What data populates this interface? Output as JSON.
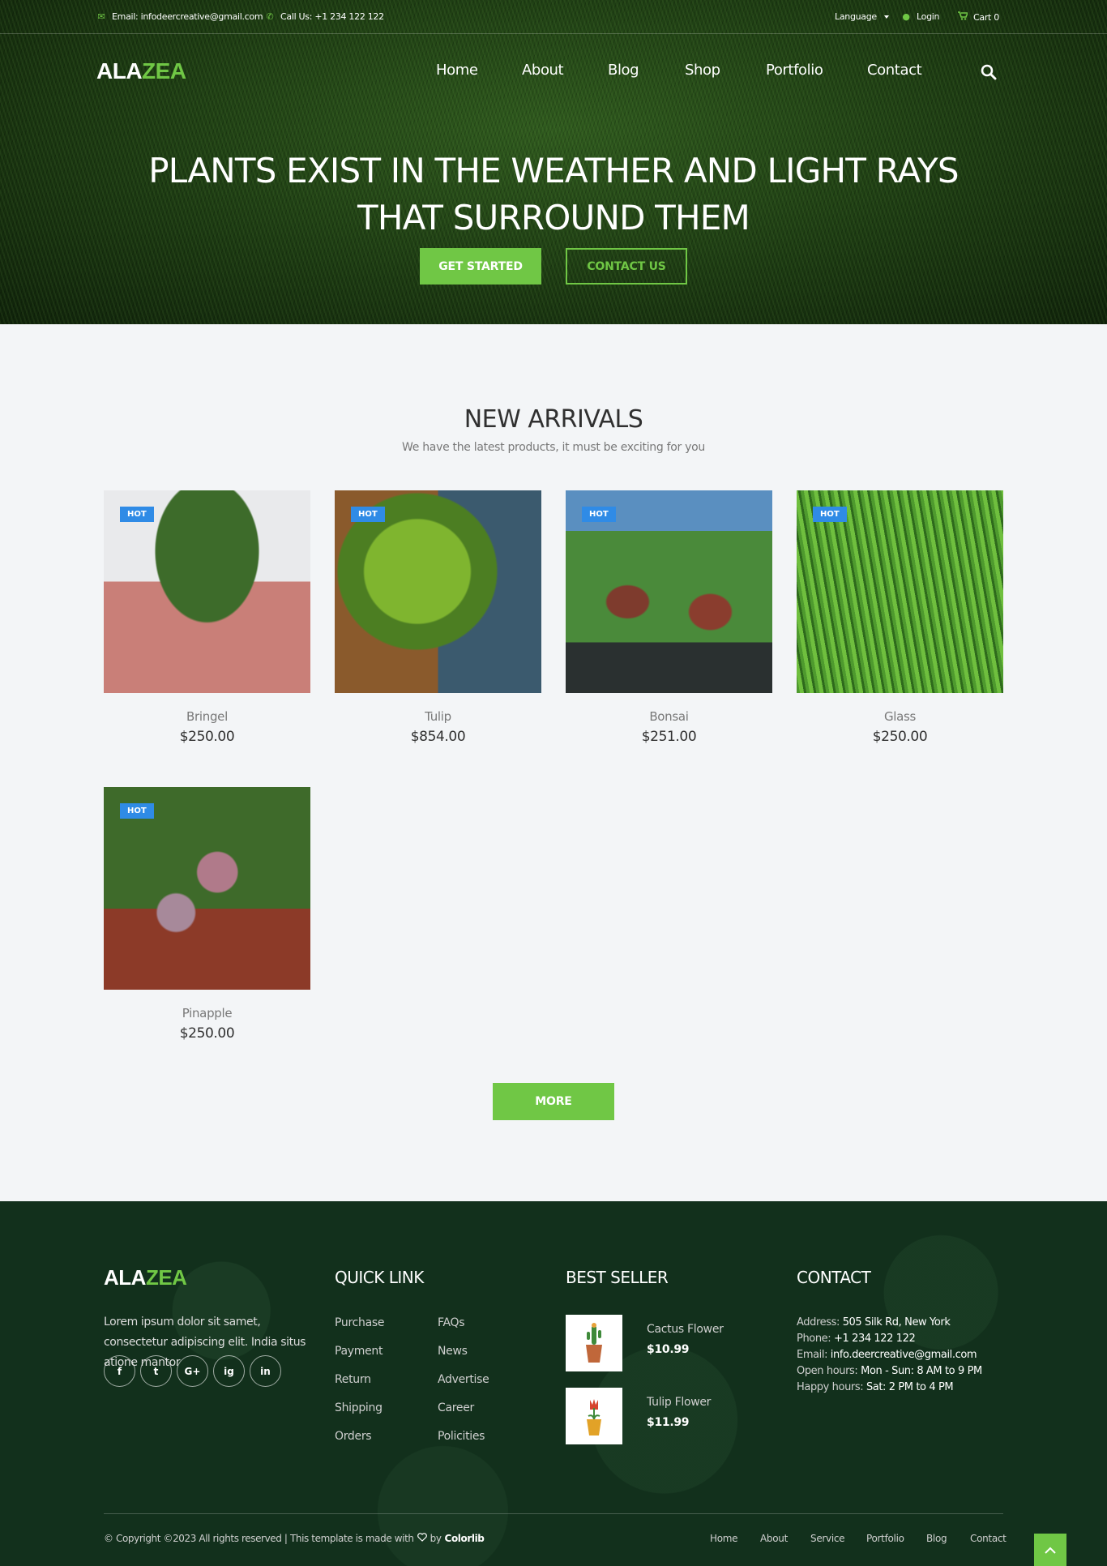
{
  "topbar": {
    "email": "Email: infodeercreative@gmail.com",
    "call": "Call Us: +1 234 122 122",
    "language": "Language",
    "login": "Login",
    "cart": "Cart 0"
  },
  "logo": {
    "part1": "ALA",
    "part2": "ZEA"
  },
  "nav": [
    "Home",
    "About",
    "Blog",
    "Shop",
    "Portfolio",
    "Contact"
  ],
  "hero": {
    "title": "PLANTS EXIST IN THE WEATHER AND LIGHT RAYS THAT SURROUND THEM",
    "btn_start": "GET STARTED",
    "btn_contact": "CONTACT US"
  },
  "arrivals": {
    "title": "NEW ARRIVALS",
    "subtitle": "We have the latest products, it must be exciting for you",
    "badge": "HOT",
    "products": [
      {
        "name": "Bringel",
        "price": "$250.00"
      },
      {
        "name": "Tulip",
        "price": "$854.00"
      },
      {
        "name": "Bonsai",
        "price": "$251.00"
      },
      {
        "name": "Glass",
        "price": "$250.00"
      },
      {
        "name": "Pinapple",
        "price": "$250.00"
      }
    ],
    "more": "MORE"
  },
  "footer": {
    "about": "Lorem ipsum dolor sit samet, consectetur adipiscing elit. India situs atione mantor",
    "social": [
      "f",
      "t",
      "G+",
      "ig",
      "in"
    ],
    "quick_title": "QUICK LINK",
    "quick_links": [
      "Purchase",
      "Payment",
      "Return",
      "Shipping",
      "Orders",
      "FAQs",
      "News",
      "Advertise",
      "Career",
      "Policities"
    ],
    "best_title": "BEST SELLER",
    "best": [
      {
        "name": "Cactus Flower",
        "price": "$10.99"
      },
      {
        "name": "Tulip Flower",
        "price": "$11.99"
      }
    ],
    "contact_title": "CONTACT",
    "contact": [
      {
        "label": "Address:",
        "value": "505 Silk Rd, New York"
      },
      {
        "label": "Phone:",
        "value": "+1 234 122 122"
      },
      {
        "label": "Email:",
        "value": "info.deercreative@gmail.com"
      },
      {
        "label": "Open hours:",
        "value": "Mon - Sun: 8 AM to 9 PM"
      },
      {
        "label": "Happy hours:",
        "value": "Sat: 2 PM to 4 PM"
      }
    ],
    "copyright": "© Copyright ©2023 All rights reserved | This template is made with",
    "by": "by",
    "colorlib": "Colorlib",
    "bottom_nav": [
      "Home",
      "About",
      "Service",
      "Portfolio",
      "Blog",
      "Contact"
    ]
  },
  "colors": {
    "accent": "#70c745",
    "badge": "#2f8be6",
    "footer_bg": "#12301c"
  }
}
